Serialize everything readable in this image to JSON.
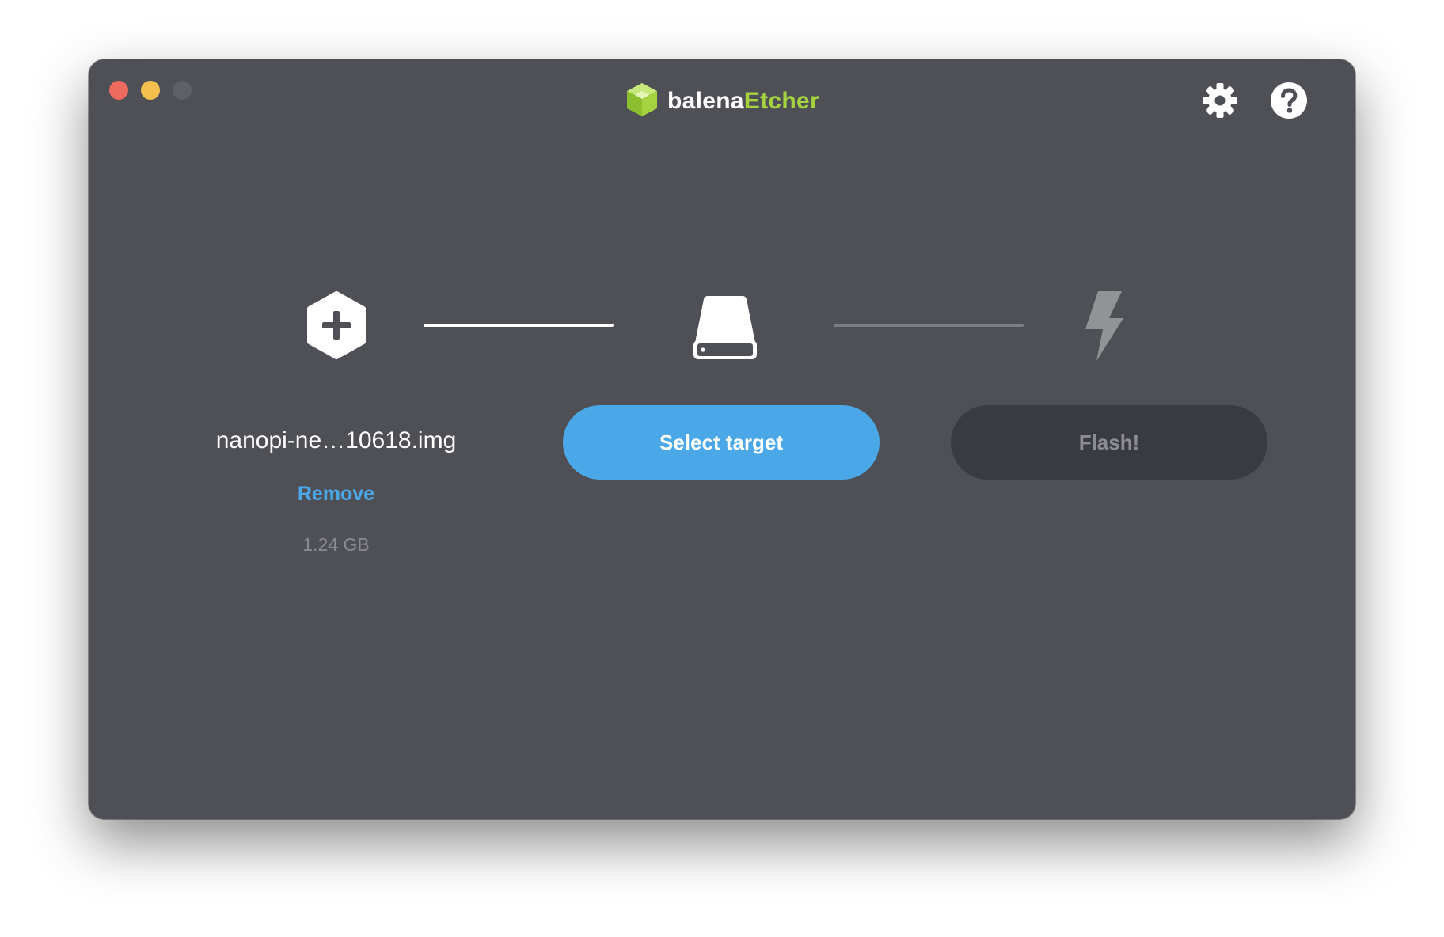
{
  "app": {
    "brand_part1": "balena",
    "brand_part2": "Etcher",
    "logo_icon": "cube-logo-icon"
  },
  "colors": {
    "window_bg": "#4f5056",
    "close": "#ed6a5e",
    "minimize": "#f5bf4f",
    "maximize": "#5f6066",
    "accent_blue": "#4aa8e9",
    "brand_green": "#a5d33f",
    "flash_button_bg": "#3a3b40",
    "connector_active": "#ffffff",
    "connector_inactive": "#7d7e83",
    "inactive_icon": "#929397"
  },
  "header": {
    "settings_icon": "gear-icon",
    "help_icon": "question-circle-icon"
  },
  "steps": {
    "source": {
      "icon": "plus-hexagon-icon",
      "file_name": "nanopi-ne…10618.img",
      "remove_label": "Remove",
      "file_size": "1.24 GB"
    },
    "target": {
      "icon": "drive-icon",
      "button_label": "Select target"
    },
    "flash": {
      "icon": "lightning-bolt-icon",
      "button_label": "Flash!"
    }
  }
}
